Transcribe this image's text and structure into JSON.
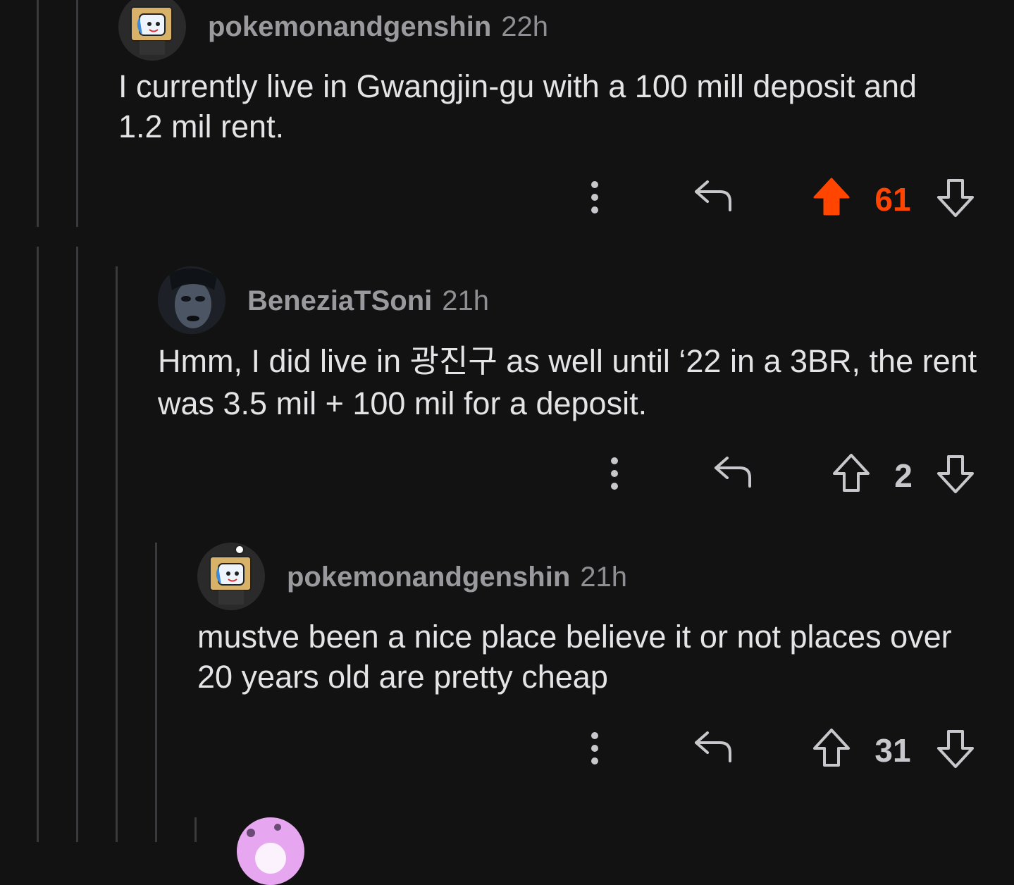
{
  "comments": [
    {
      "user": "pokemonandgenshin",
      "time": "22h",
      "avatar": "tv-box-head-avatar",
      "text": "I currently live in Gwangjin-gu with a 100 mill deposit and 1.2 mil rent.",
      "score": "61",
      "upvoted": true
    },
    {
      "user": "BeneziaTSoni",
      "time": "21h",
      "avatar": "dark-face-avatar",
      "text": "Hmm, I did live in 광진구 as well until ‘22 in a 3BR, the rent was 3.5 mil + 100 mil for a deposit.",
      "score": "2",
      "upvoted": false
    },
    {
      "user": "pokemonandgenshin",
      "time": "21h",
      "avatar": "tv-box-head-avatar",
      "text": "mustve been a nice place believe it or not places over 20 years old are pretty cheap",
      "score": "31",
      "upvoted": false
    }
  ],
  "colors": {
    "background": "#121212",
    "upvote_active": "#ff4500",
    "thread_line": "#3a3a3c",
    "icon": "#c8c8cc"
  }
}
